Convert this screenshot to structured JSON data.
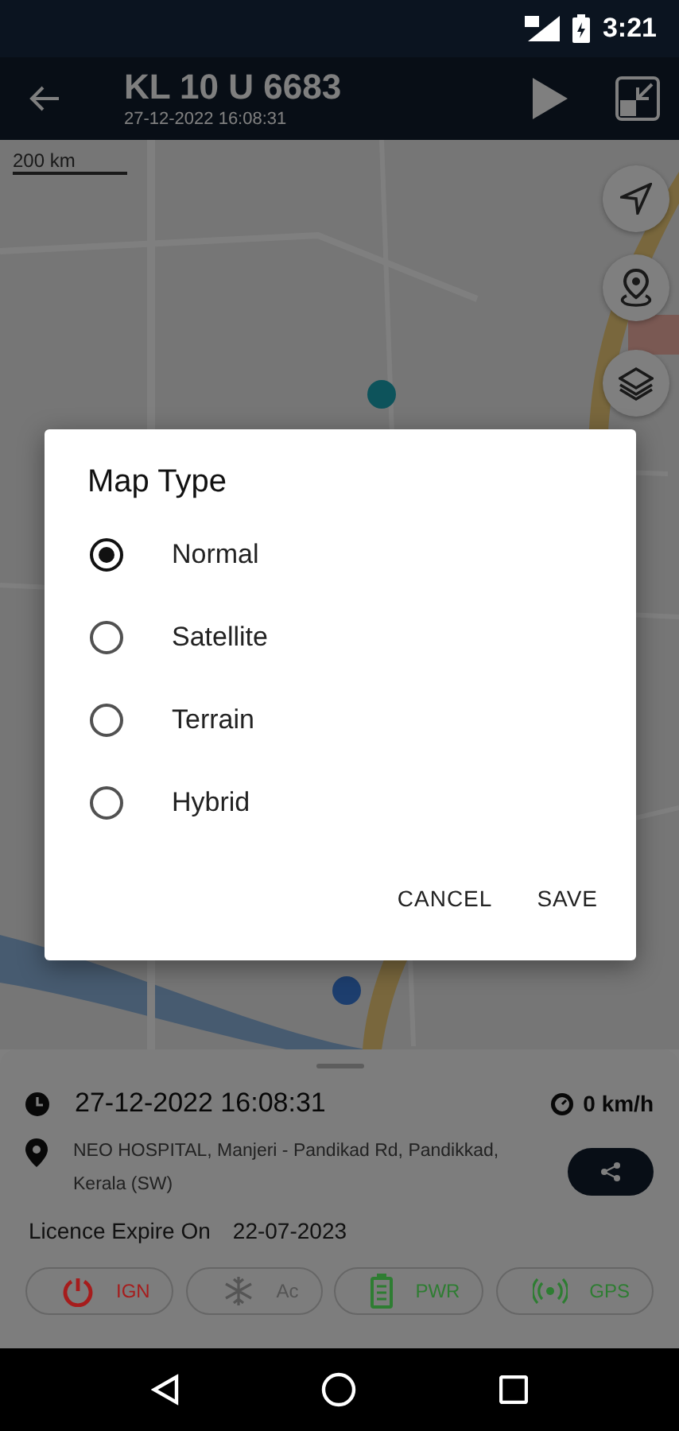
{
  "status_bar": {
    "time": "3:21"
  },
  "app_bar": {
    "title": "KL 10 U 6683",
    "subtitle": "27-12-2022 16:08:31"
  },
  "map": {
    "kind": "picture",
    "scale": "200 km"
  },
  "dialog": {
    "title": "Map Type",
    "options": [
      {
        "label": "Normal",
        "selected": true
      },
      {
        "label": "Satellite",
        "selected": false
      },
      {
        "label": "Terrain",
        "selected": false
      },
      {
        "label": "Hybrid",
        "selected": false
      }
    ],
    "buttons": [
      "CANCEL",
      "SAVE"
    ]
  },
  "details": {
    "datetime": "27-12-2022 16:08:31",
    "speed": "0 km/h",
    "address": "NEO HOSPITAL, Manjeri - Pandikad Rd, Pandikkad, Kerala (SW)",
    "licence_label": "Licence Expire On",
    "licence_date": "22-07-2023",
    "chips": [
      {
        "kind": "ignition",
        "label": "IGN",
        "color": "#a61c1c"
      },
      {
        "kind": "ac",
        "label": "Ac",
        "color": "#555555"
      },
      {
        "kind": "power",
        "label": "PWR",
        "color": "#2e7d32"
      },
      {
        "kind": "gps",
        "label": "GPS",
        "color": "#2e7d32"
      }
    ]
  }
}
